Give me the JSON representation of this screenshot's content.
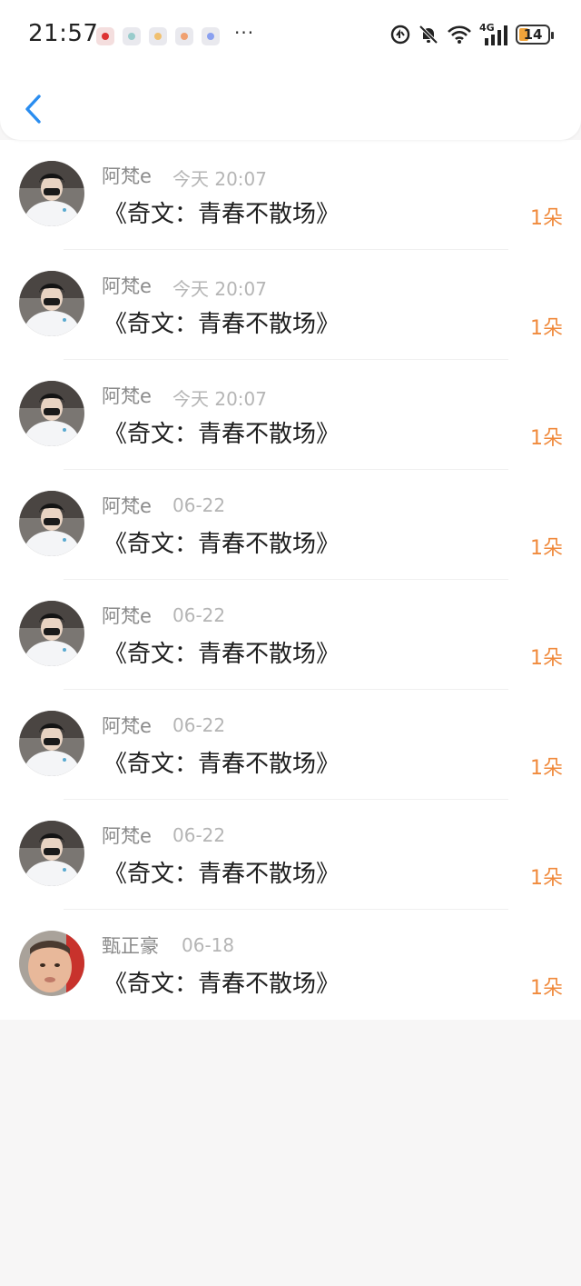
{
  "status_bar": {
    "time": "21:57",
    "more_indicator": "···",
    "network_label": "4G",
    "battery_level": "14",
    "icons": [
      "notification-app-icon",
      "data-saver-icon",
      "mute-bell-icon",
      "wifi-icon",
      "signal-icon",
      "battery-icon"
    ]
  },
  "header": {
    "back_icon": "chevron-left-icon",
    "accent_color": "#2a8df0"
  },
  "colors": {
    "count": "#f08a3c",
    "name": "#8a8a8a",
    "date": "#b5b5b5"
  },
  "items": [
    {
      "name": "阿梵e",
      "date": "今天 20:07",
      "title": "《奇文：青春不散场》",
      "count": "1朵",
      "avatar": "avatar-a"
    },
    {
      "name": "阿梵e",
      "date": "今天 20:07",
      "title": "《奇文：青春不散场》",
      "count": "1朵",
      "avatar": "avatar-a"
    },
    {
      "name": "阿梵e",
      "date": "今天 20:07",
      "title": "《奇文：青春不散场》",
      "count": "1朵",
      "avatar": "avatar-a"
    },
    {
      "name": "阿梵e",
      "date": "06-22",
      "title": "《奇文：青春不散场》",
      "count": "1朵",
      "avatar": "avatar-a"
    },
    {
      "name": "阿梵e",
      "date": "06-22",
      "title": "《奇文：青春不散场》",
      "count": "1朵",
      "avatar": "avatar-a"
    },
    {
      "name": "阿梵e",
      "date": "06-22",
      "title": "《奇文：青春不散场》",
      "count": "1朵",
      "avatar": "avatar-a"
    },
    {
      "name": "阿梵e",
      "date": "06-22",
      "title": "《奇文：青春不散场》",
      "count": "1朵",
      "avatar": "avatar-a"
    },
    {
      "name": "甄正豪",
      "date": "06-18",
      "title": "《奇文：青春不散场》",
      "count": "1朵",
      "avatar": "avatar-b"
    }
  ]
}
